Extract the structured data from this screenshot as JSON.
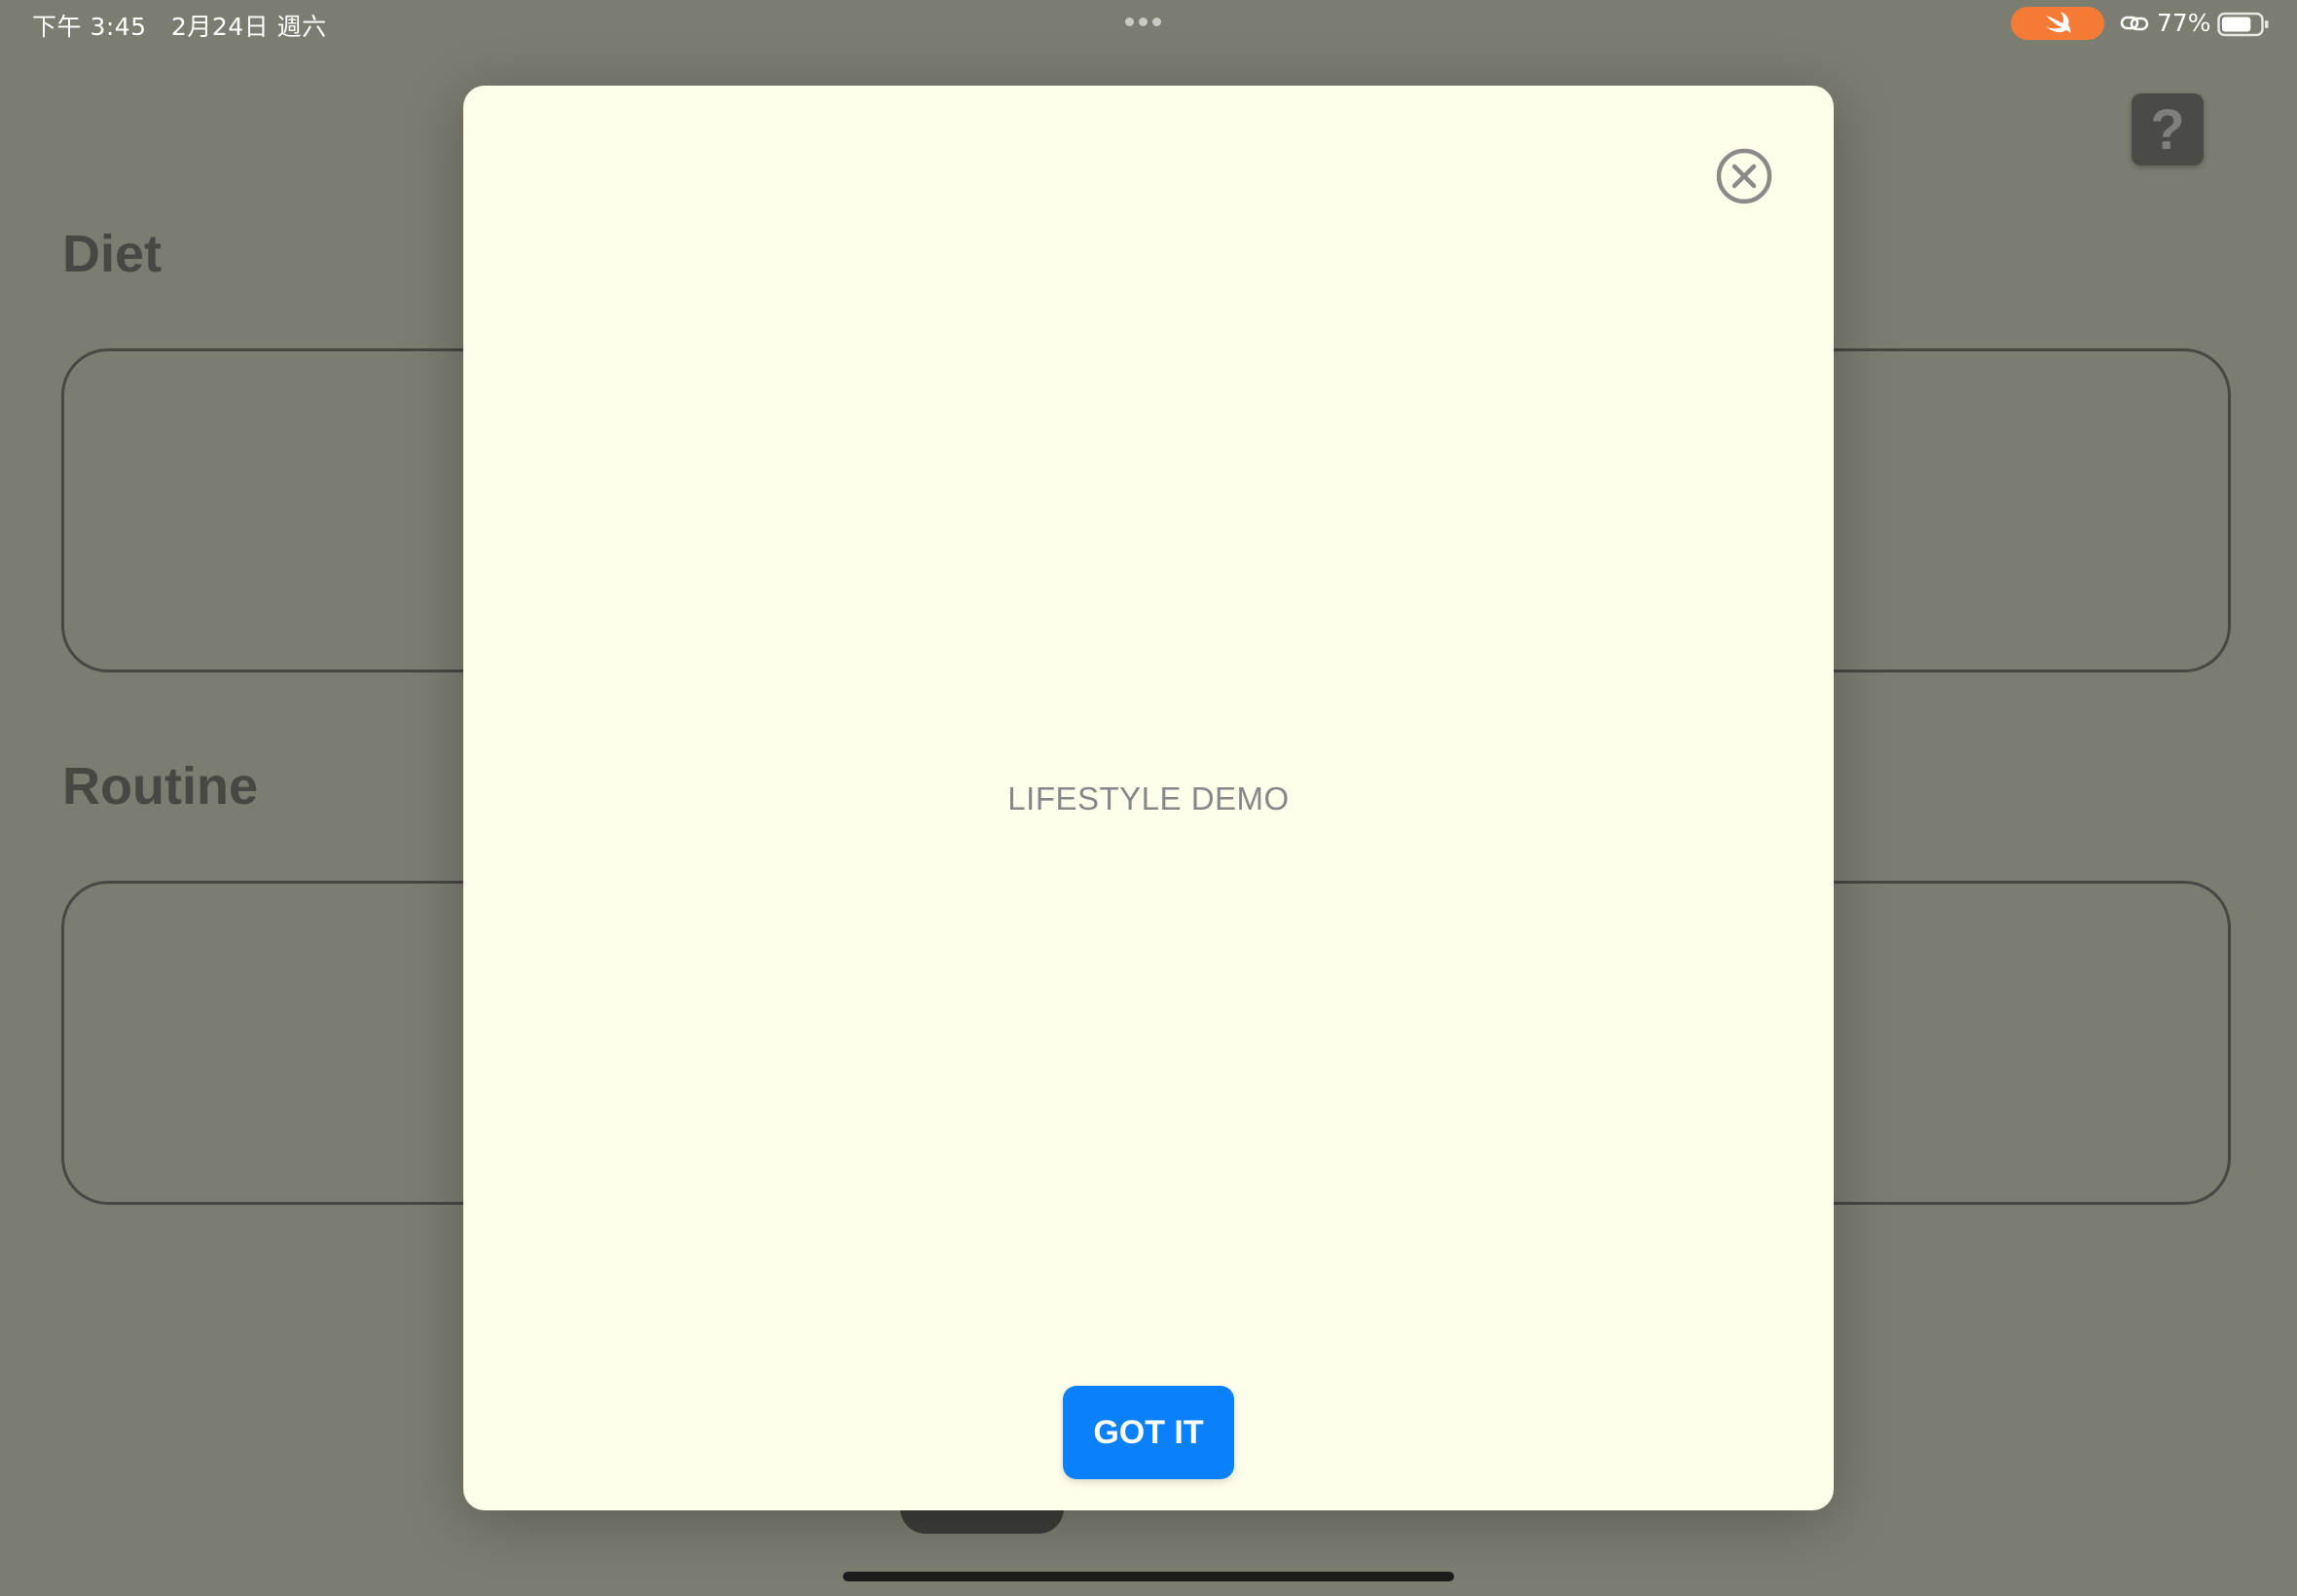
{
  "status_bar": {
    "time_date": "下午 3:45   2月24日 週六",
    "battery_percent": "77%",
    "battery_level": 0.77,
    "swift_pill_color": "#f47a35"
  },
  "background": {
    "help_label": "?",
    "sections": [
      {
        "title": "Diet"
      },
      {
        "title": "Routine"
      }
    ]
  },
  "modal": {
    "caption": "LIFESTYLE DEMO",
    "got_it_label": "GOT IT",
    "accent_color": "#0b80fb",
    "background_color": "#fffeea",
    "close_icon": "close-circle-icon"
  }
}
